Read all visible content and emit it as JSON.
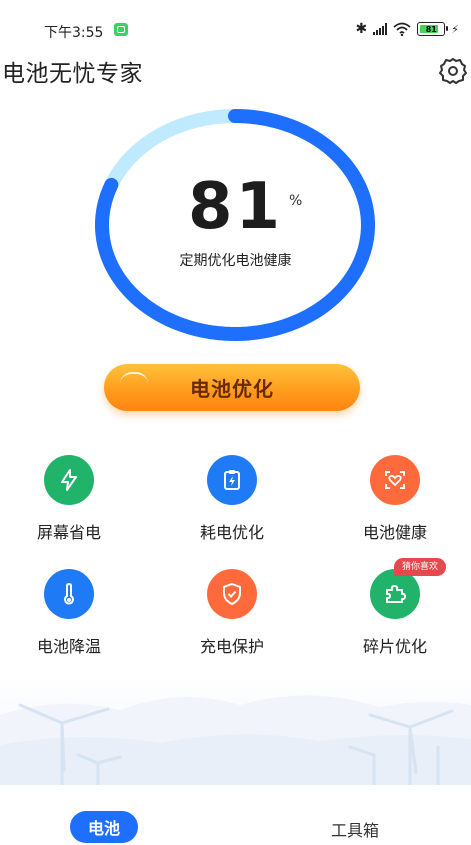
{
  "status_bar": {
    "time": "下午3:55",
    "battery_level": "81",
    "battery_fraction": 0.81,
    "icons": [
      "wechat-notification-icon",
      "bluetooth-icon",
      "signal-icon",
      "wifi-icon",
      "battery-icon",
      "charging-bolt-icon"
    ]
  },
  "header": {
    "title": "电池无忧专家",
    "settings_icon": "gear-icon"
  },
  "gauge": {
    "value": "81",
    "unit": "%",
    "fraction": 0.81,
    "subtitle": "定期优化电池健康",
    "colors": {
      "progress": "#1f6fff",
      "track": "#bfeaff"
    }
  },
  "optimize_button": {
    "label": "电池优化",
    "colors": {
      "from": "#ffc23a",
      "to": "#ff8412"
    }
  },
  "features": [
    {
      "label": "屏幕省电",
      "icon": "lightning-icon",
      "color": "#21b36a"
    },
    {
      "label": "耗电优化",
      "icon": "battery-clipboard-icon",
      "color": "#1f7af5"
    },
    {
      "label": "电池健康",
      "icon": "heart-scan-icon",
      "color": "#ff6a3d"
    },
    {
      "label": "电池降温",
      "icon": "thermometer-icon",
      "color": "#1f7af5"
    },
    {
      "label": "充电保护",
      "icon": "shield-icon",
      "color": "#ff6a3d"
    },
    {
      "label": "碎片优化",
      "icon": "puzzle-icon",
      "color": "#21b36a"
    }
  ],
  "badge": {
    "label": "猜你喜欢"
  },
  "bottom_nav": {
    "tabs": [
      {
        "label": "电池",
        "active": true
      },
      {
        "label": "工具箱",
        "active": false
      }
    ]
  }
}
